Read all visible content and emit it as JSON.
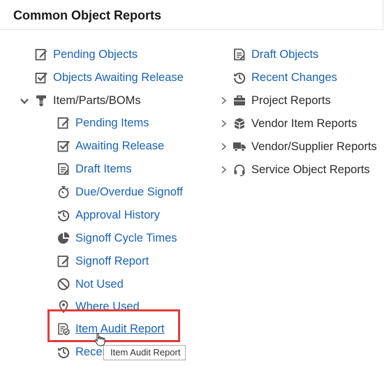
{
  "header": {
    "title": "Common Object Reports"
  },
  "left": {
    "pending_objects": "Pending Objects",
    "objects_awaiting_release": "Objects Awaiting Release",
    "item_group": "Item/Parts/BOMs",
    "children": {
      "pending_items": "Pending Items",
      "awaiting_release": "Awaiting Release",
      "draft_items": "Draft Items",
      "due_overdue_signoff": "Due/Overdue Signoff",
      "approval_history": "Approval History",
      "signoff_cycle_times": "Signoff Cycle Times",
      "signoff_report": "Signoff Report",
      "not_used": "Not Used",
      "where_used": "Where Used",
      "item_audit_report": "Item Audit Report",
      "recent_partial": "Recen"
    }
  },
  "right": {
    "draft_objects": "Draft Objects",
    "recent_changes": "Recent Changes",
    "project_reports": "Project Reports",
    "vendor_item_reports": "Vendor Item Reports",
    "vendor_supplier_reports": "Vendor/Supplier Reports",
    "service_object_reports": "Service Object Reports"
  },
  "tooltip": {
    "text": "Item Audit Report"
  },
  "colors": {
    "link": "#1a62b5",
    "icon": "#555555",
    "highlight": "#e03c3c"
  }
}
